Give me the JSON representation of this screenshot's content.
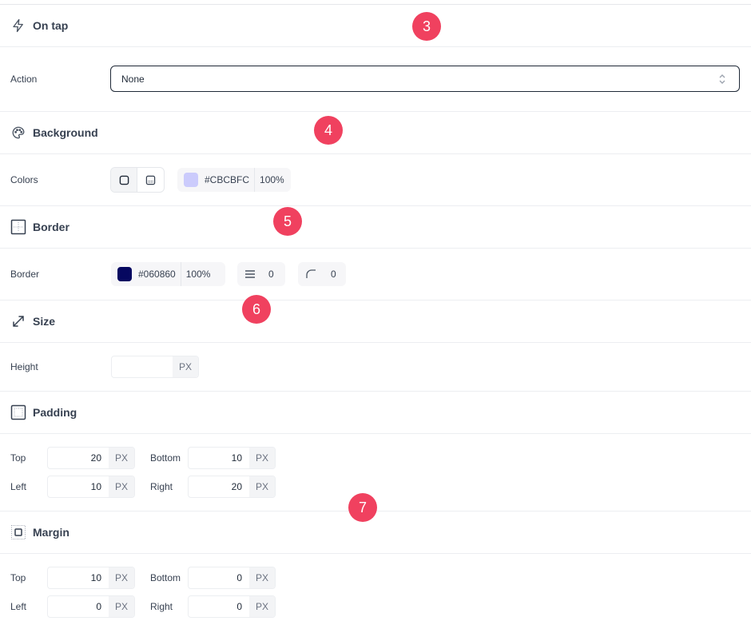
{
  "on_tap": {
    "title": "On tap",
    "action_label": "Action",
    "action_value": "None"
  },
  "background": {
    "title": "Background",
    "colors_label": "Colors",
    "color_hex": "#CBCBFC",
    "color_opacity": "100%",
    "swatch_color": "#cbcbfc"
  },
  "border": {
    "title": "Border",
    "row_label": "Border",
    "color_hex": "#060860",
    "color_opacity": "100%",
    "swatch_color": "#060860",
    "width_value": "0",
    "radius_value": "0"
  },
  "size": {
    "title": "Size",
    "height_label": "Height",
    "height_value": "",
    "unit": "PX"
  },
  "padding": {
    "title": "Padding",
    "top_label": "Top",
    "top_value": "20",
    "bottom_label": "Bottom",
    "bottom_value": "10",
    "left_label": "Left",
    "left_value": "10",
    "right_label": "Right",
    "right_value": "20",
    "unit": "PX"
  },
  "margin": {
    "title": "Margin",
    "top_label": "Top",
    "top_value": "10",
    "bottom_label": "Bottom",
    "bottom_value": "0",
    "left_label": "Left",
    "left_value": "0",
    "right_label": "Right",
    "right_value": "0",
    "unit": "PX"
  },
  "badges": [
    "3",
    "4",
    "5",
    "6",
    "7"
  ],
  "colors": {
    "badge": "#f0415f"
  },
  "icons": {
    "on_tap": "lightning-icon",
    "background": "palette-icon",
    "border": "border-icon",
    "size": "resize-icon",
    "padding": "padding-icon",
    "margin": "margin-icon"
  }
}
